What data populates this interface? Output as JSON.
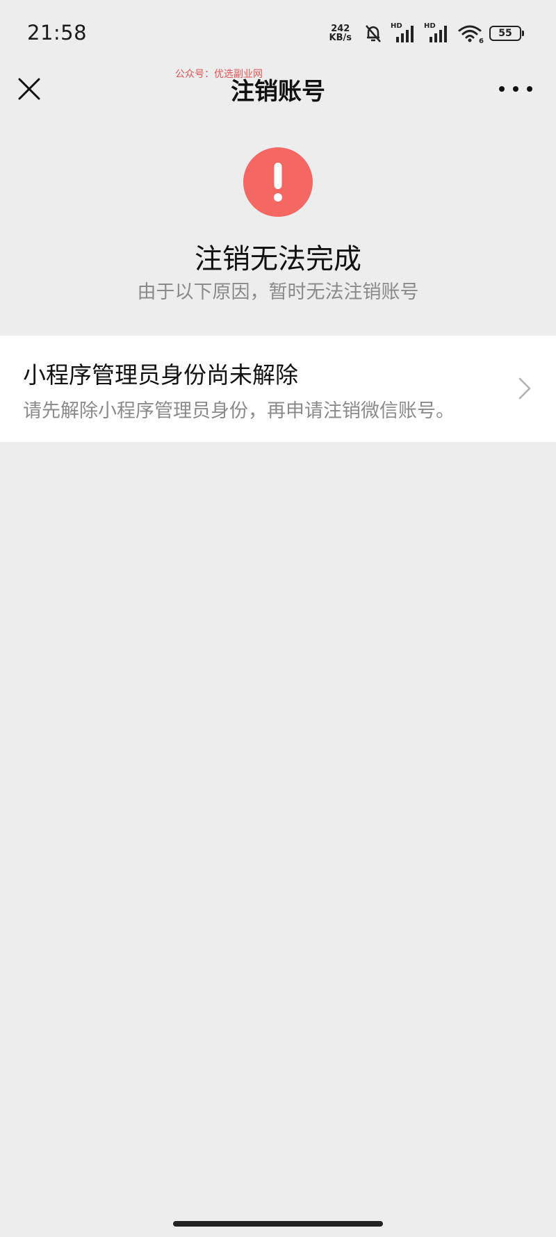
{
  "status_bar": {
    "time": "21:58",
    "net_speed_value": "242",
    "net_speed_unit": "KB/s",
    "sim1_label": "HD",
    "sim2_label": "HD",
    "wifi_label": "6",
    "battery": "55"
  },
  "nav": {
    "title": "注销账号",
    "watermark": "公众号：优选副业网"
  },
  "result": {
    "title": "注销无法完成",
    "subtitle": "由于以下原因，暂时无法注销账号"
  },
  "reason": {
    "title": "小程序管理员身份尚未解除",
    "description": "请先解除小程序管理员身份，再申请注销微信账号。"
  },
  "colors": {
    "background": "#ededed",
    "warning": "#f46762",
    "card": "#ffffff",
    "secondary_text": "#8a8a8a"
  }
}
